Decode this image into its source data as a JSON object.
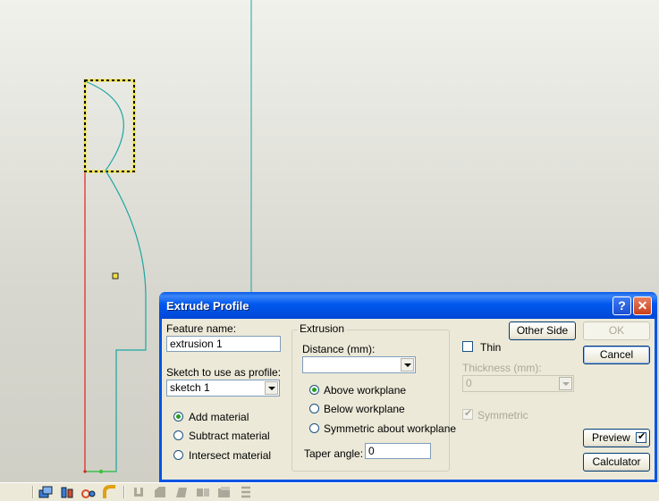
{
  "dialog": {
    "title": "Extrude Profile",
    "help_glyph": "?",
    "close_glyph": "✕",
    "feature_name": {
      "label": "Feature name:",
      "value": "extrusion 1"
    },
    "sketch": {
      "label": "Sketch to use as profile:",
      "value": "sketch 1"
    },
    "operation": {
      "options": [
        "Add material",
        "Subtract material",
        "Intersect material"
      ],
      "selected_index": 0
    },
    "extrusion": {
      "group_label": "Extrusion",
      "distance_label": "Distance (mm):",
      "distance_value": "",
      "direction_options": [
        "Above workplane",
        "Below workplane",
        "Symmetric about workplane"
      ],
      "selected_index": 0,
      "taper_label": "Taper angle:",
      "taper_value": "0"
    },
    "thin": {
      "label": "Thin",
      "checked": false,
      "thickness_label": "Thickness (mm):",
      "thickness_value": "0",
      "symmetric_label": "Symmetric",
      "symmetric_checked": true
    },
    "buttons": {
      "other_side": "Other Side",
      "ok": "OK",
      "cancel": "Cancel",
      "preview": "Preview",
      "preview_checked": true,
      "calculator": "Calculator"
    }
  },
  "toolbar": {
    "icons": [
      "extrude-icon",
      "revolve-icon",
      "sweep-icon",
      "fillet-icon",
      "shell-icon",
      "chamfer-icon",
      "draft-icon",
      "pattern-icon",
      "mirror-icon",
      "loft-icon"
    ]
  },
  "colors": {
    "profile_red": "#e02020",
    "profile_teal": "#1aa6a0",
    "selection_yellow": "#f0e040",
    "xp_blue": "#0054e3"
  }
}
